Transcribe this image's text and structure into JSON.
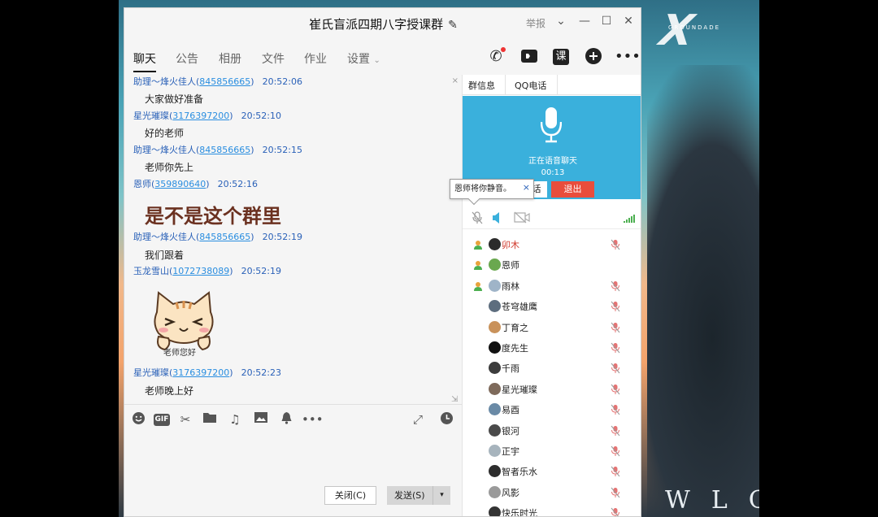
{
  "window": {
    "title": "崔氏盲派四期八字授课群",
    "report_label": "举报",
    "controls": {
      "dropdown": "⌄",
      "minimize": "—",
      "maximize": "☐",
      "close": "✕"
    }
  },
  "tabs": [
    "聊天",
    "公告",
    "相册",
    "文件",
    "作业",
    "设置"
  ],
  "header_icons": {
    "ke_label": "课"
  },
  "messages": [
    {
      "sender": "助理～烽火佳人",
      "qq": "845856665",
      "time": "20:52:06",
      "text": "大家做好准备"
    },
    {
      "sender": "星光璀璨",
      "qq": "3176397200",
      "time": "20:52:10",
      "text": "好的老师"
    },
    {
      "sender": "助理～烽火佳人",
      "qq": "845856665",
      "time": "20:52:15",
      "text": "老师你先上"
    },
    {
      "sender": "恩师",
      "qq": "359890640",
      "time": "20:52:16",
      "text": "是不是这个群里"
    },
    {
      "sender": "助理～烽火佳人",
      "qq": "845856665",
      "time": "20:52:19",
      "text": "我们跟着"
    },
    {
      "sender": "玉龙雪山",
      "qq": "1072738089",
      "time": "20:52:19",
      "sticker_caption": "老师您好"
    },
    {
      "sender": "星光璀璨",
      "qq": "3176397200",
      "time": "20:52:23",
      "text": "老师晚上好"
    }
  ],
  "toolbar_icons": [
    "emoji-icon",
    "gif-icon",
    "scissors-icon",
    "folder-icon",
    "music-icon",
    "image-icon",
    "bell-icon",
    "more-icon"
  ],
  "gif_label": "GIF",
  "buttons": {
    "close": "关闭(C)",
    "send": "发送(S)"
  },
  "right_panel": {
    "tabs": [
      "群信息",
      "QQ电话"
    ],
    "voice_status": "正在语音聊天",
    "voice_timer": "00:13",
    "hidden_button_fragment": "话",
    "exit_label": "退出",
    "tooltip": "恩师将你静音。"
  },
  "members": [
    {
      "name": "卯木",
      "role": true,
      "host": true,
      "muted": true,
      "avatar": "#2b2b2b"
    },
    {
      "name": "恩师",
      "role": true,
      "host": false,
      "muted": false,
      "avatar": "#6aa84f"
    },
    {
      "name": "雨林",
      "role": true,
      "host": false,
      "muted": true,
      "avatar": "#9fb4c8"
    },
    {
      "name": "苍穹雄鹰",
      "role": false,
      "muted": true,
      "avatar": "#5d6d7e"
    },
    {
      "name": "丁育之",
      "role": false,
      "muted": true,
      "avatar": "#c9925b"
    },
    {
      "name": "度先生",
      "role": false,
      "muted": true,
      "avatar": "#111111"
    },
    {
      "name": "千雨",
      "role": false,
      "muted": true,
      "avatar": "#3c3c3c"
    },
    {
      "name": "星光璀璨",
      "role": false,
      "muted": true,
      "avatar": "#7e6a5b"
    },
    {
      "name": "易酉",
      "role": false,
      "muted": true,
      "avatar": "#6a8aa6"
    },
    {
      "name": "银河",
      "role": false,
      "muted": true,
      "avatar": "#4a4a4a"
    },
    {
      "name": "正宇",
      "role": false,
      "muted": true,
      "avatar": "#a7b4bd"
    },
    {
      "name": "智者乐水",
      "role": false,
      "muted": true,
      "avatar": "#2d2d2d"
    },
    {
      "name": "风影",
      "role": false,
      "muted": true,
      "avatar": "#9a9a9a"
    },
    {
      "name": "快乐时光",
      "role": false,
      "muted": true,
      "avatar": "#333333"
    }
  ],
  "wallpaper": {
    "text": "WLC",
    "brand": "X",
    "brand_text": "GROUNDADE"
  }
}
